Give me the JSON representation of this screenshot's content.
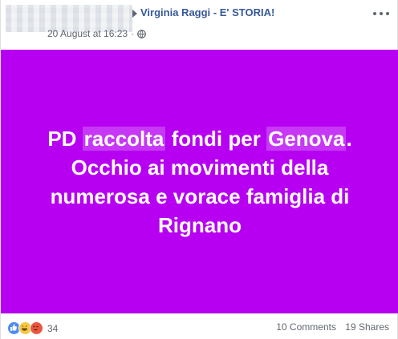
{
  "header": {
    "group_name": "Virginia Raggi - E' STORIA!",
    "date": "20 August at 16:23",
    "separator": "·",
    "privacy_icon": "globe-icon",
    "more_icon": "more-options-icon"
  },
  "post": {
    "background_color": "#b700f2",
    "text_part1": "PD ",
    "text_hl1": "raccolta",
    "text_part2": " fondi per ",
    "text_hl2": "Genova",
    "text_part3": ". Occhio ai movimenti della numerosa e vorace famiglia di Rignano"
  },
  "footer": {
    "reaction_icons": [
      "like-icon",
      "haha-icon",
      "angry-icon"
    ],
    "reaction_count": "34",
    "comments": "10 Comments",
    "shares": "19 Shares"
  }
}
